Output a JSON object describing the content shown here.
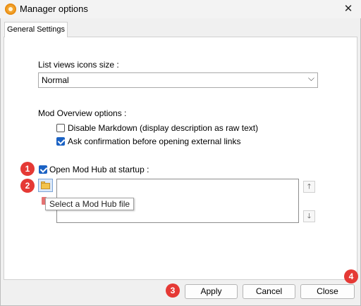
{
  "window": {
    "title": "Manager options",
    "close_glyph": "✕"
  },
  "tabs": [
    {
      "label": "General Settings"
    }
  ],
  "list_views": {
    "label": "List views icons size :",
    "selected": "Normal",
    "caret": "⌵"
  },
  "mod_overview": {
    "label": "Mod Overview options :",
    "options": [
      {
        "label": "Disable Markdown (display description as raw text)",
        "checked": false
      },
      {
        "label": "Ask confirmation before opening external links",
        "checked": true
      }
    ]
  },
  "mod_hub": {
    "label": "Open Mod Hub at startup :",
    "checked": true,
    "tooltip": "Select a Mod Hub file",
    "up_glyph": "🡑",
    "down_glyph": "🡓"
  },
  "badges": [
    "1",
    "2",
    "3",
    "4"
  ],
  "footer": {
    "apply": "Apply",
    "cancel": "Cancel",
    "close": "Close"
  },
  "colors": {
    "accent": "#1b62c4",
    "badge": "#e53935"
  }
}
